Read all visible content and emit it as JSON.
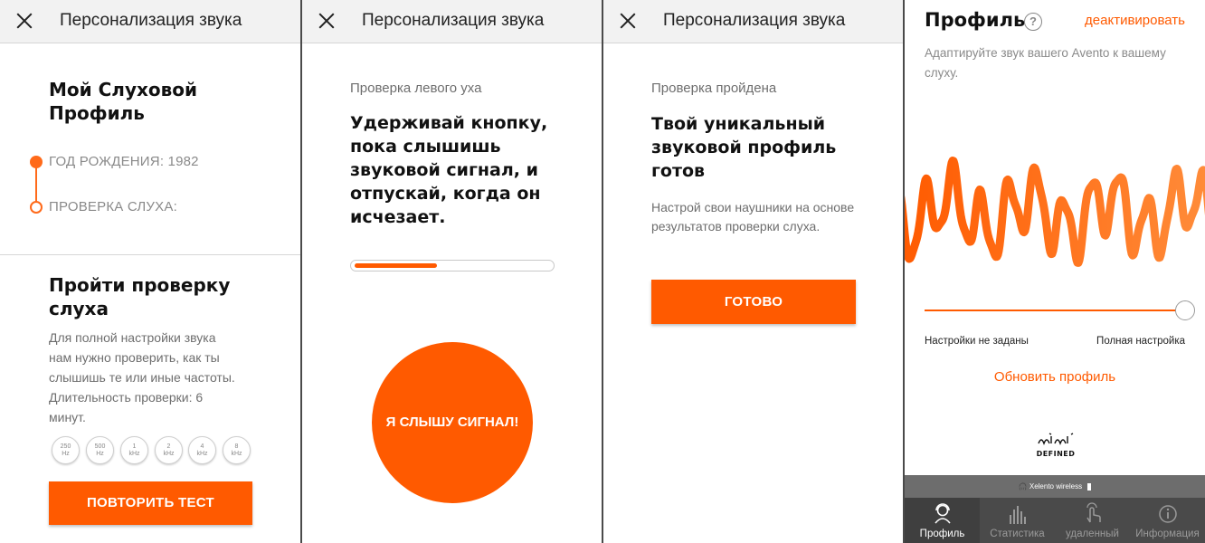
{
  "colors": {
    "accent": "#ff5a00",
    "header_bg": "#f2f2f2",
    "tabbar_bg": "#4a4a4a"
  },
  "panel1": {
    "header_title": "Персонализация звука",
    "profile_title": "Мой Слуховой Профиль",
    "birth_year_label": "ГОД РОЖДЕНИЯ: 1982",
    "hearing_test_label": "ПРОВЕРКА СЛУХА:",
    "test_title": "Пройти проверку слуха",
    "test_desc": "Для полной настройки звука нам нужно проверить, как ты слышишь те или иные частоты. Длительность проверки: 6 минут.",
    "frequencies": [
      {
        "value": "250",
        "unit": "Hz"
      },
      {
        "value": "500",
        "unit": "Hz"
      },
      {
        "value": "1",
        "unit": "kHz"
      },
      {
        "value": "2",
        "unit": "kHz"
      },
      {
        "value": "4",
        "unit": "kHz"
      },
      {
        "value": "8",
        "unit": "kHz"
      }
    ],
    "repeat_button": "ПОВТОРИТЬ ТЕСТ"
  },
  "panel2": {
    "header_title": "Персонализация звука",
    "subtitle": "Проверка левого уха",
    "instruction": "Удерживай кнопку, пока слышишь звуковой сигнал, и отпускай, когда он исчезает.",
    "progress_fraction": 0.42,
    "hear_button": "Я СЛЫШУ СИГНАЛ!"
  },
  "panel3": {
    "header_title": "Персонализация звука",
    "subtitle": "Проверка пройдена",
    "heading": "Твой уникальный звуковой профиль готов",
    "desc": "Настрой свои наушники на основе результатов проверки слуха.",
    "done_button": "ГОТОВО"
  },
  "panel4": {
    "title": "Профиль",
    "help_icon": "?",
    "deactivate_link": "деактивировать",
    "desc": "Адаптируйте звук вашего Avento к вашему слуху.",
    "slider_value": 1.0,
    "slider_left_label": "Настройки не заданы",
    "slider_right_label": "Полная настройка",
    "update_link": "Обновить профиль",
    "logo_text": "mimi DEFINED",
    "device_name": "Xelento wireless",
    "tabs": [
      {
        "label": "Профиль",
        "icon": "profile-icon",
        "active": true
      },
      {
        "label": "Статистика",
        "icon": "statistics-icon",
        "active": false
      },
      {
        "label": "удаленный",
        "icon": "remote-icon",
        "active": false
      },
      {
        "label": "Информация",
        "icon": "info-icon",
        "active": false
      }
    ]
  }
}
